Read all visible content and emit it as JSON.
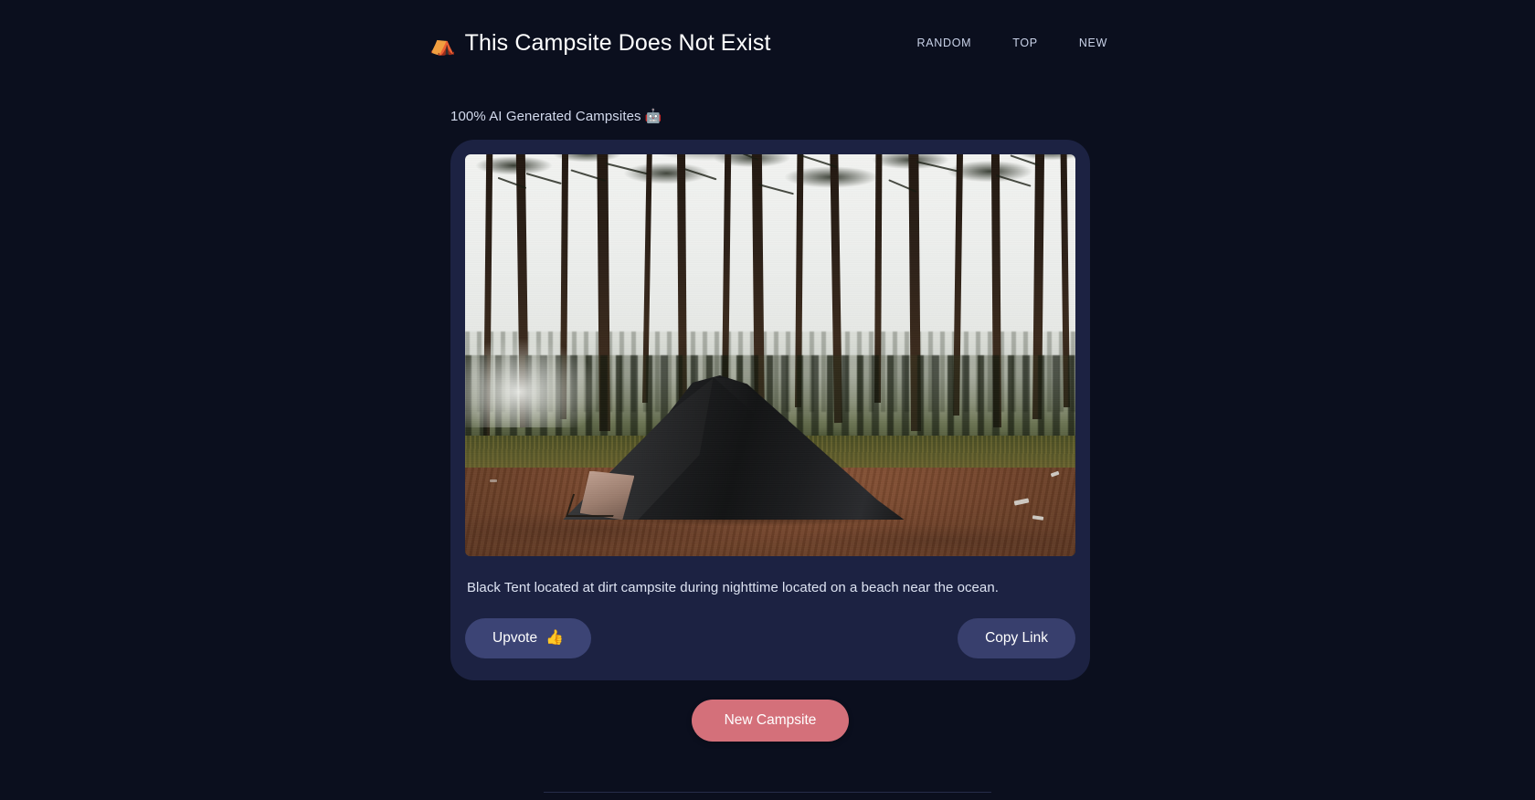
{
  "header": {
    "brand_icon": "tent-icon",
    "brand_icon_glyph": "⛺",
    "brand_title": "This Campsite Does Not Exist",
    "nav": [
      {
        "id": "random",
        "label": "RANDOM"
      },
      {
        "id": "top",
        "label": "TOP"
      },
      {
        "id": "new",
        "label": "NEW"
      }
    ]
  },
  "main": {
    "tagline": "100% AI Generated Campsites 🤖",
    "card": {
      "image_alt": "Black tent pitched on bare reddish dirt in a misty pine forest under a bright overcast sky",
      "caption": "Black Tent located at dirt campsite during nighttime located on a beach near the ocean.",
      "upvote_label": "Upvote",
      "upvote_emoji": "👍",
      "copy_link_label": "Copy Link"
    },
    "new_campsite_label": "New Campsite"
  },
  "colors": {
    "page_background": "#0b0f1e",
    "card_background": "#1c2242",
    "accent_red": "#d4707a",
    "button_blue": "#3c4475",
    "brand_orange": "#f5a623",
    "text_primary": "#ffffff",
    "text_secondary": "#d4dbee",
    "nav_link": "#c9d2e8",
    "divider": "#262c4a"
  }
}
